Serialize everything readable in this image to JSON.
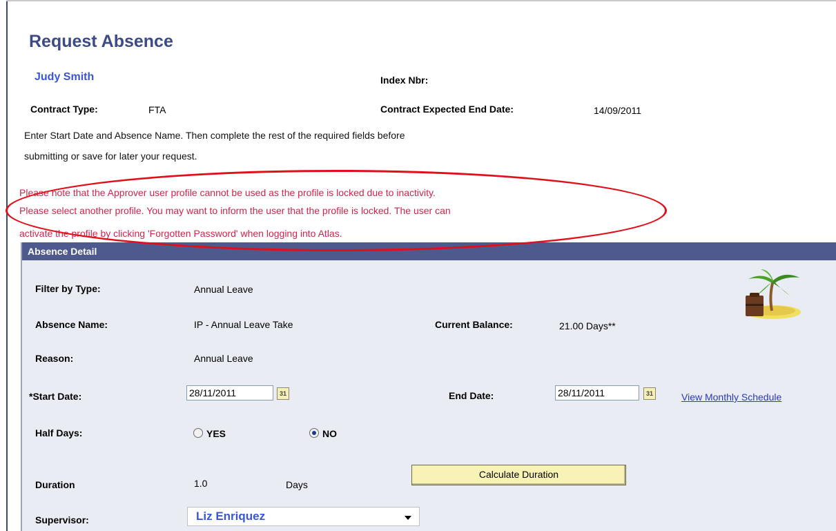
{
  "page": {
    "title": "Request Absence",
    "user_name": "Judy Smith",
    "index_nbr_label": "Index Nbr:",
    "contract_type_label": "Contract Type:",
    "contract_type_value": "FTA",
    "contract_end_label": "Contract Expected End Date:",
    "contract_end_value": "14/09/2011",
    "instructions": [
      "Enter Start Date and Absence Name. Then complete the rest of the required fields before",
      "submitting or save for later your request."
    ],
    "warning_lines": [
      "Please note that the Approver user profile cannot be used as the profile is locked due to inactivity.",
      "Please select another profile. You may want to inform the user that the profile is locked. The user can",
      "activate the profile by clicking 'Forgotten Password' when logging into Atlas."
    ]
  },
  "absence_detail": {
    "header": "Absence Detail",
    "filter_label": "Filter by Type:",
    "filter_value": "Annual Leave",
    "absence_name_label": "Absence Name:",
    "absence_name_value": "IP - Annual Leave Take",
    "balance_label": "Current Balance:",
    "balance_value": "21.00 Days**",
    "reason_label": "Reason:",
    "reason_value": "Annual Leave",
    "start_date_label": "*Start Date:",
    "start_date_value": "28/11/2011",
    "end_date_label": "End Date:",
    "end_date_value": "28/11/2011",
    "calendar_icon_text": "31",
    "view_schedule_link": "View Monthly Schedule",
    "half_days_label": "Half Days:",
    "half_days_yes": "YES",
    "half_days_no": "NO",
    "half_days_selected": "NO",
    "duration_label": "Duration",
    "duration_value": "1.0",
    "duration_unit": "Days",
    "calculate_button": "Calculate Duration",
    "supervisor_label": "Supervisor:",
    "supervisor_value": "Liz Enriquez"
  },
  "icons": {
    "vacation": "palm-tree-island-icon",
    "calendar": "calendar-icon",
    "dropdown": "chevron-down-icon"
  },
  "colors": {
    "title": "#3c4a86",
    "user_name": "#3a56d4",
    "warning_text": "#d3244b",
    "highlight_ellipse": "#e0101a",
    "panel_header_bg": "#4e5a8e",
    "panel_bg": "#e9ecf2",
    "button_bg": "#f8f3b4"
  }
}
